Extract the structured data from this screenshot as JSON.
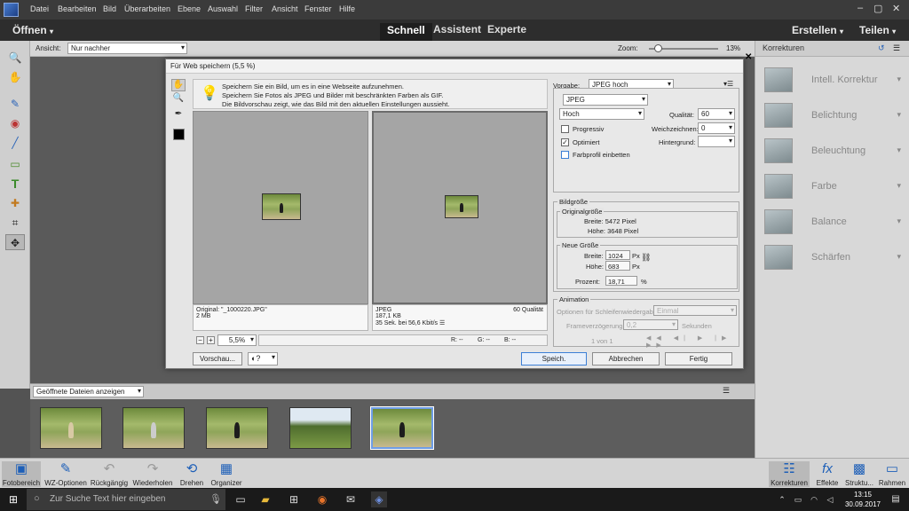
{
  "menubar": {
    "items": [
      "Datei",
      "Bearbeiten",
      "Bild",
      "Überarbeiten",
      "Ebene",
      "Auswahl",
      "Filter",
      "Ansicht",
      "Fenster",
      "Hilfe"
    ],
    "window_controls": [
      "–",
      "▢",
      "✕"
    ]
  },
  "modebar": {
    "open_label": "Öffnen",
    "modes": [
      "Schnell",
      "Assistent",
      "Experte"
    ],
    "create_label": "Erstellen",
    "share_label": "Teilen"
  },
  "optbar": {
    "view_label": "Ansicht:",
    "view_value": "Nur nachher",
    "zoom_label": "Zoom:",
    "zoom_value": "13%",
    "zoom_level": 0.13
  },
  "rightpanel": {
    "title": "Korrekturen",
    "items": [
      "Intell. Korrektur",
      "Belichtung",
      "Beleuchtung",
      "Farbe",
      "Balance",
      "Schärfen"
    ]
  },
  "bin": {
    "label": "Geöffnete Dateien anzeigen",
    "selected_index": 4
  },
  "bottombar": {
    "left": [
      "Fotobereich",
      "WZ-Optionen",
      "Rückgängig",
      "Wiederholen",
      "Drehen",
      "Organizer"
    ],
    "right": [
      "Korrekturen",
      "Effekte",
      "Struktu...",
      "Rahmen"
    ]
  },
  "taskbar": {
    "search_placeholder": "Zur Suche Text hier eingeben",
    "time": "13:15",
    "date": "30.09.2017"
  },
  "dialog": {
    "title": "Für Web speichern (5,5 %)",
    "info_lines": [
      "Speichern Sie ein Bild, um es in eine Webseite aufzunehmen.",
      "Speichern Sie Fotos als JPEG und Bilder mit beschränkten Farben als GIF.",
      "Die Bildvorschau zeigt, wie das Bild mit den aktuellen Einstellungen aussieht."
    ],
    "original": {
      "name": "Original: \"_1000220.JPG\"",
      "size": "2 MB"
    },
    "optimized": {
      "format": "JPEG",
      "quality_note": "60 Qualität",
      "size": "187,1 KB",
      "time": "35 Sek. bei 56,6 Kbit/s"
    },
    "zoom_value": "5,5%",
    "readout": {
      "r": "R: --",
      "g": "G: --",
      "b": "B: --"
    },
    "preset_label": "Vorgabe:",
    "preset_value": "JPEG hoch",
    "format_value": "JPEG",
    "quality_level": "Hoch",
    "quality_label": "Qualität:",
    "quality_value": "60",
    "progressive_label": "Progressiv",
    "blur_label": "Weichzeichnen:",
    "blur_value": "0",
    "optimized_label": "Optimiert",
    "background_label": "Hintergrund:",
    "embed_profile_label": "Farbprofil einbetten",
    "image_size_title": "Bildgröße",
    "original_size_title": "Originalgröße",
    "orig_width": "Breite: 5472 Pixel",
    "orig_height": "Höhe: 3648 Pixel",
    "new_size_title": "Neue Größe",
    "width_label": "Breite:",
    "width_value": "1024",
    "height_label": "Höhe:",
    "height_value": "683",
    "unit_px": "Px",
    "percent_label": "Prozent:",
    "percent_value": "18,71",
    "percent_unit": "%",
    "animation_title": "Animation",
    "loop_label": "Optionen für Schleifenwiedergabe:",
    "loop_value": "Einmal",
    "frame_delay_label": "Frameverzögerung:",
    "frame_delay_value": "0,2",
    "seconds_label": "Sekunden",
    "frame_counter": "1 von 1",
    "buttons": {
      "preview": "Vorschau...",
      "save": "Speich.",
      "cancel": "Abbrechen",
      "done": "Fertig"
    }
  }
}
